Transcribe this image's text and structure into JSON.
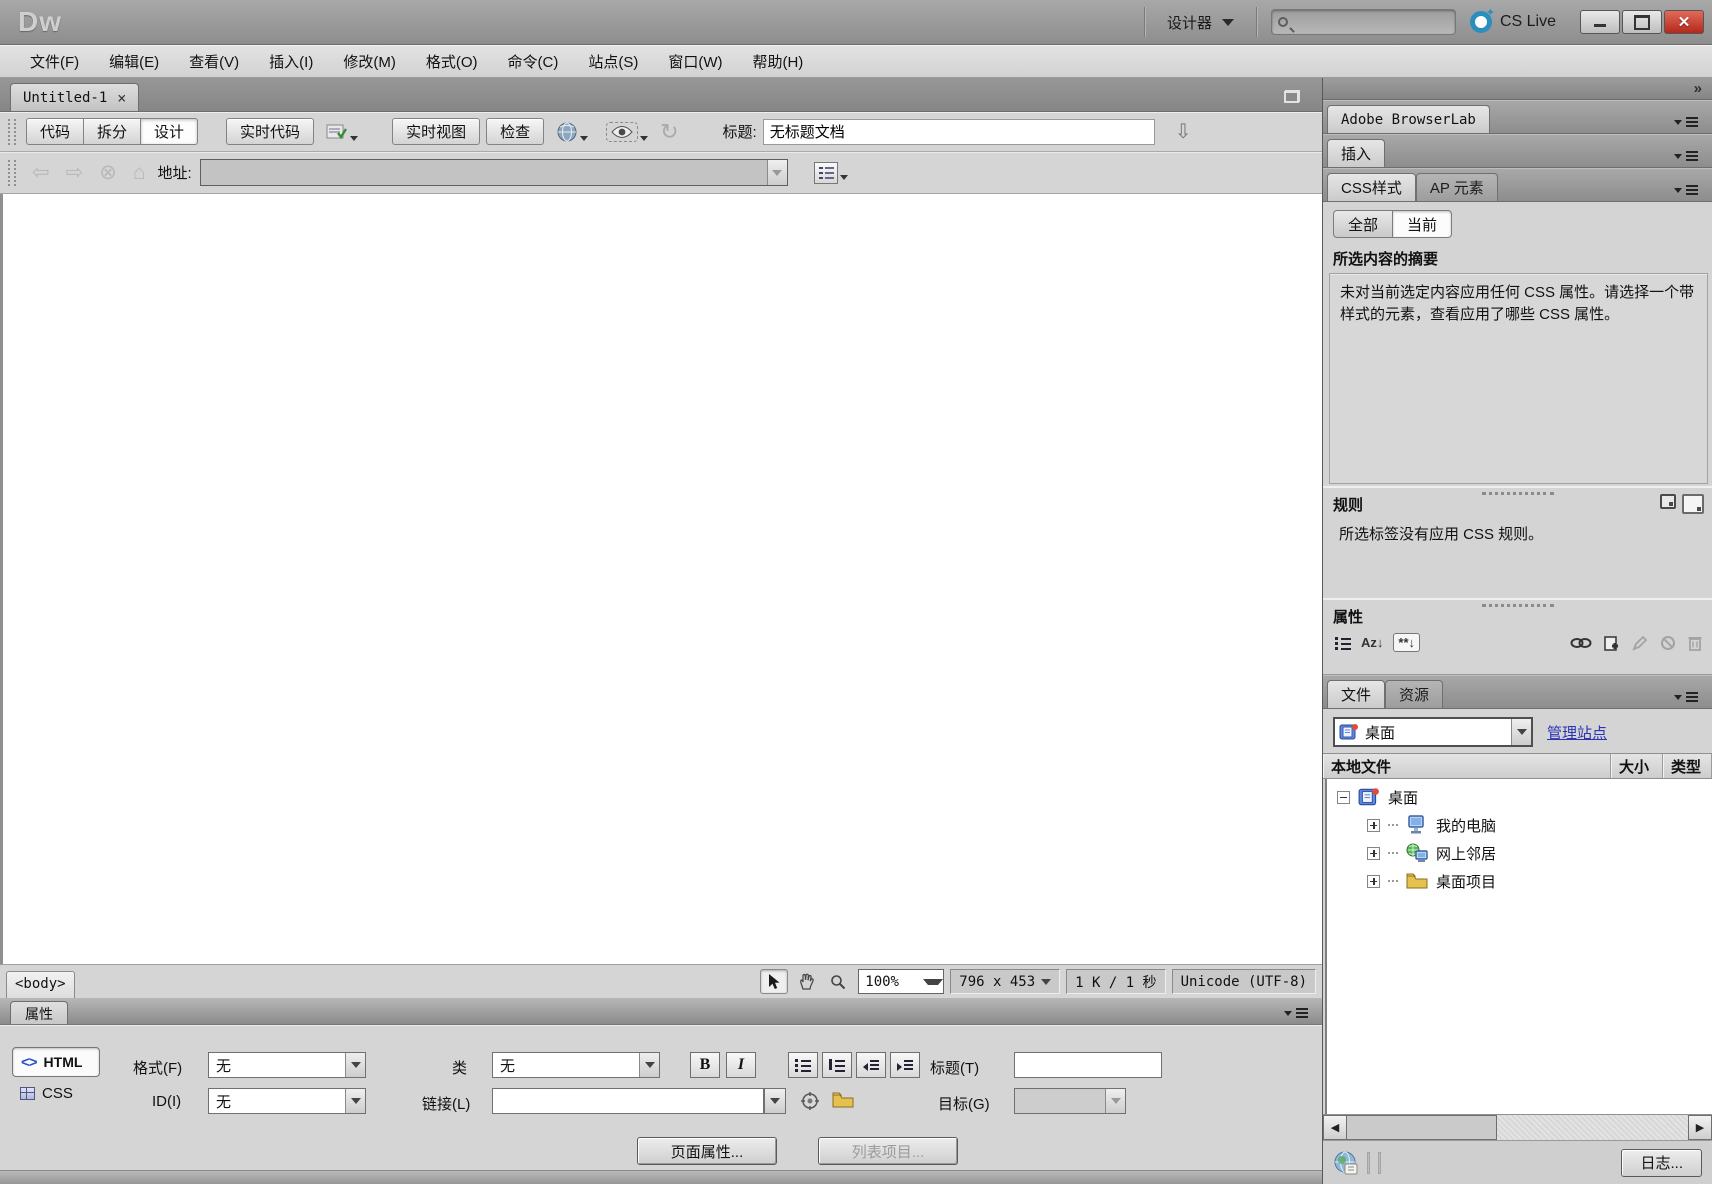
{
  "icons": {
    "close": "×",
    "collapse": "»",
    "back": "⇦",
    "forward": "⇨",
    "stop": "⊗",
    "home": "⌂",
    "refresh": "↻",
    "file_management": "⇩",
    "sort_az": "Az↓",
    "sort_custom": "**↓",
    "scroll_left": "◀",
    "scroll_right": "▶",
    "chain": "∞",
    "pencil": "✎",
    "ban": "⃠",
    "trash": "🗑"
  },
  "titlebar": {
    "logo": "Dw",
    "workspace": "设计器",
    "cs_live": "CS Live"
  },
  "menubar": {
    "items": [
      "文件(F)",
      "编辑(E)",
      "查看(V)",
      "插入(I)",
      "修改(M)",
      "格式(O)",
      "命令(C)",
      "站点(S)",
      "窗口(W)",
      "帮助(H)"
    ]
  },
  "document": {
    "tab": "Untitled-1",
    "views": [
      "代码",
      "拆分",
      "设计"
    ],
    "live_code": "实时代码",
    "live_view": "实时视图",
    "inspect": "检查",
    "title_label": "标题:",
    "title_value": "无标题文档",
    "address_label": "地址:"
  },
  "statusbar": {
    "tag": "<body>",
    "zoom": "100%",
    "size": "796 x 453",
    "stats": "1 K / 1 秒",
    "encoding": "Unicode (UTF-8)"
  },
  "properties": {
    "panel_tab": "属性",
    "html": "HTML",
    "css": "CSS",
    "format_label": "格式(F)",
    "format_value": "无",
    "id_label": "ID(I)",
    "id_value": "无",
    "class_label": "类",
    "class_value": "无",
    "link_label": "链接(L)",
    "bold": "B",
    "italic": "I",
    "doc_title_label": "标题(T)",
    "target_label": "目标(G)",
    "page_props": "页面属性...",
    "list_item": "列表项目..."
  },
  "dock": {
    "browserlab": "Adobe BrowserLab",
    "insert": "插入",
    "css_styles_tab": "CSS样式",
    "ap_elements_tab": "AP 元素",
    "all": "全部",
    "current": "当前",
    "summary_title": "所选内容的摘要",
    "summary_text": "未对当前选定内容应用任何 CSS 属性。请选择一个带样式的元素，查看应用了哪些 CSS 属性。",
    "rules_title": "规则",
    "rules_text": "所选标签没有应用 CSS 规则。",
    "props_title": "属性",
    "files_tab": "文件",
    "assets_tab": "资源",
    "site": "桌面",
    "manage_sites": "管理站点",
    "columns": {
      "local": "本地文件",
      "size": "大小",
      "type": "类型"
    },
    "tree": [
      {
        "label": "桌面"
      },
      {
        "label": "我的电脑"
      },
      {
        "label": "网上邻居"
      },
      {
        "label": "桌面项目"
      }
    ],
    "log_button": "日志..."
  }
}
